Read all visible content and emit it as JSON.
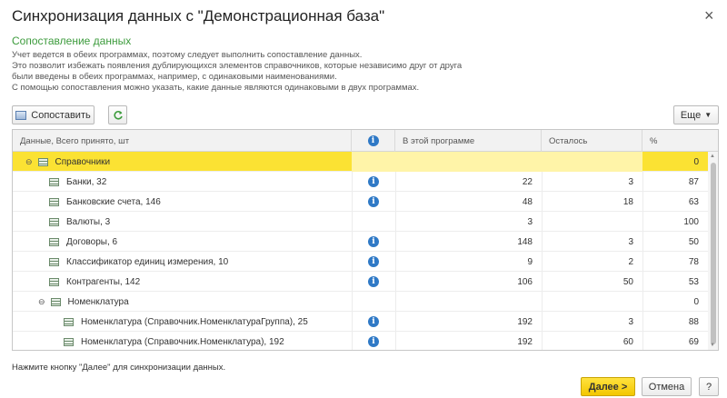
{
  "window": {
    "title": "Синхронизация данных с \"Демонстрационная база\"",
    "close": "×"
  },
  "section": {
    "title": "Сопоставление данных",
    "description": [
      "Учет ведется в обеих программах, поэтому следует выполнить сопоставление данных.",
      "Это позволит избежать появления дублирующихся элементов справочников, которые независимо друг от друга",
      "были введены в обеих программах, например, с одинаковыми наименованиями.",
      "С помощью сопоставления можно указать, какие данные являются одинаковыми в двух программах."
    ]
  },
  "toolbar": {
    "match_label": "Сопоставить",
    "more_label": "Еще"
  },
  "table": {
    "headers": {
      "data": "Данные, Всего принято, шт",
      "info": "i",
      "this_program": "В этой программе",
      "remaining": "Осталось",
      "percent": "%"
    },
    "rows": [
      {
        "name": "Справочники",
        "info": "",
        "this_program": "",
        "remaining": "",
        "percent": "0"
      },
      {
        "name": "Банки, 32",
        "info": "i",
        "this_program": "22",
        "remaining": "3",
        "percent": "87"
      },
      {
        "name": "Банковские счета, 146",
        "info": "i",
        "this_program": "48",
        "remaining": "18",
        "percent": "63"
      },
      {
        "name": "Валюты, 3",
        "info": "",
        "this_program": "3",
        "remaining": "",
        "percent": "100"
      },
      {
        "name": "Договоры, 6",
        "info": "i",
        "this_program": "148",
        "remaining": "3",
        "percent": "50"
      },
      {
        "name": "Классификатор единиц измерения, 10",
        "info": "i",
        "this_program": "9",
        "remaining": "2",
        "percent": "78"
      },
      {
        "name": "Контрагенты, 142",
        "info": "i",
        "this_program": "106",
        "remaining": "50",
        "percent": "53"
      },
      {
        "name": "Номенклатура",
        "info": "",
        "this_program": "",
        "remaining": "",
        "percent": "0"
      },
      {
        "name": "Номенклатура (Справочник.НоменклатураГруппа), 25",
        "info": "i",
        "this_program": "192",
        "remaining": "3",
        "percent": "88"
      },
      {
        "name": "Номенклатура (Справочник.Номенклатура), 192",
        "info": "i",
        "this_program": "192",
        "remaining": "60",
        "percent": "69"
      }
    ]
  },
  "footer": {
    "hint": "Нажмите кнопку \"Далее\" для синхронизации данных.",
    "next_label": "Далее >",
    "cancel_label": "Отмена",
    "help_label": "?"
  },
  "colors": {
    "accent": "#3c9b3c",
    "selection": "#fbe233",
    "info": "#2f79c6",
    "primary_button": "#f3c700"
  }
}
